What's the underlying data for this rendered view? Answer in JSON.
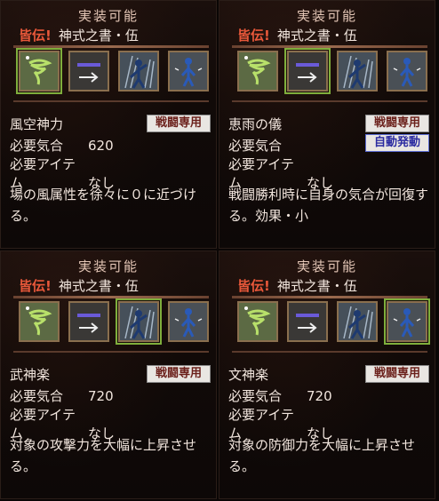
{
  "panels": [
    {
      "title": "実装可能",
      "tag": "皆伝!",
      "book": "神式之書・伍",
      "skill": "風空神力",
      "badge": "戦闘専用",
      "badge2": "",
      "req_ki_label": "必要気合",
      "req_ki": "620",
      "req_item_label": "必要アイテム",
      "req_item": "なし",
      "desc": "場の風属性を徐々に０に近づける。",
      "selected_index": 0
    },
    {
      "title": "実装可能",
      "tag": "皆伝!",
      "book": "神式之書・伍",
      "skill": "恵雨の儀",
      "badge": "戦闘専用",
      "badge2": "自動発動",
      "req_ki_label": "必要気合",
      "req_ki": "",
      "req_item_label": "必要アイテム",
      "req_item": "なし",
      "desc": "戦闘勝利時に自身の気合が回復する。効果・小",
      "selected_index": 1
    },
    {
      "title": "実装可能",
      "tag": "皆伝!",
      "book": "神式之書・伍",
      "skill": "武神楽",
      "badge": "戦闘専用",
      "badge2": "",
      "req_ki_label": "必要気合",
      "req_ki": "720",
      "req_item_label": "必要アイテム",
      "req_item": "なし",
      "desc": "対象の攻撃力を大幅に上昇させる。",
      "selected_index": 2
    },
    {
      "title": "実装可能",
      "tag": "皆伝!",
      "book": "神式之書・伍",
      "skill": "文神楽",
      "badge": "戦闘専用",
      "badge2": "",
      "req_ki_label": "必要気合",
      "req_ki": "720",
      "req_item_label": "必要アイテム",
      "req_item": "なし",
      "desc": "対象の防御力を大幅に上昇させる。",
      "selected_index": 3
    }
  ],
  "icon_names": [
    "whirlwind-icon",
    "arrow-bar-icon",
    "warrior-aura-icon",
    "figure-icon"
  ],
  "colors": {
    "tag": "#e8583a",
    "selection": "#7fae3c",
    "text": "#f2e6de"
  }
}
